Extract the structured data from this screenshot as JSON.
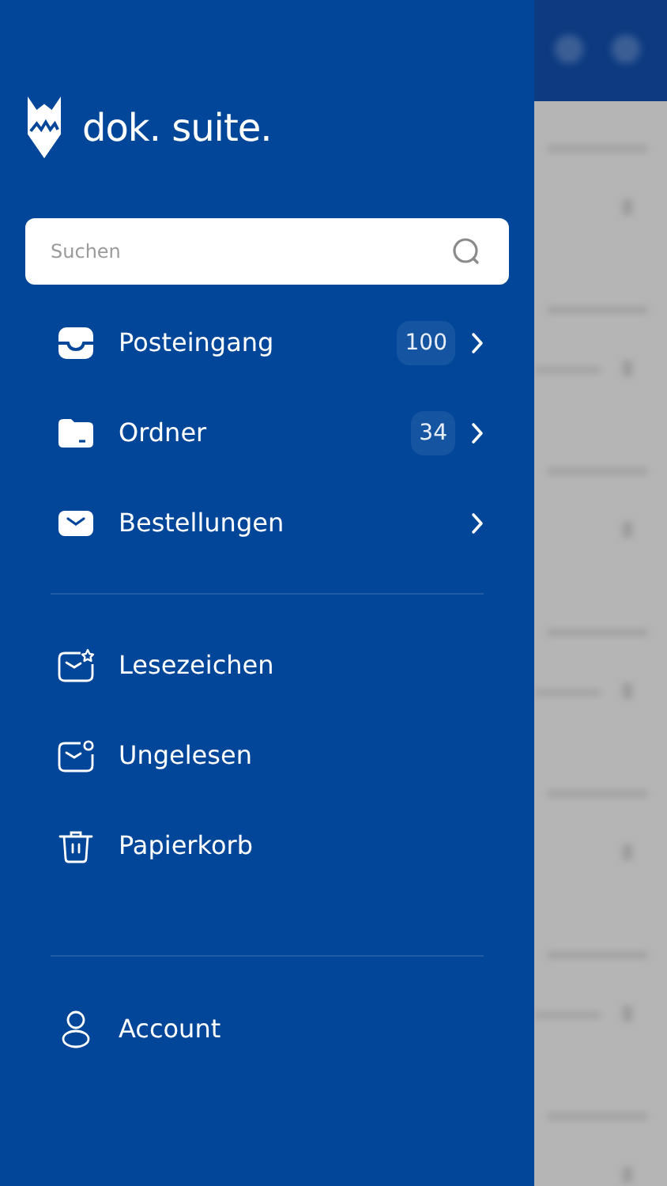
{
  "logo": {
    "text": "dok. suite."
  },
  "search": {
    "placeholder": "Suchen"
  },
  "main_items": [
    {
      "label": "Posteingang",
      "badge": "100",
      "has_submenu": true
    },
    {
      "label": "Ordner",
      "badge": "34",
      "has_submenu": true
    },
    {
      "label": "Bestellungen",
      "has_submenu": true
    }
  ],
  "secondary_items": [
    {
      "label": "Lesezeichen",
      "has_submenu": false
    },
    {
      "label": "Ungelesen",
      "has_submenu": false
    },
    {
      "label": "Papierkorb",
      "has_submenu": false
    }
  ],
  "account_items": [
    {
      "label": "Account",
      "has_submenu": false
    }
  ]
}
